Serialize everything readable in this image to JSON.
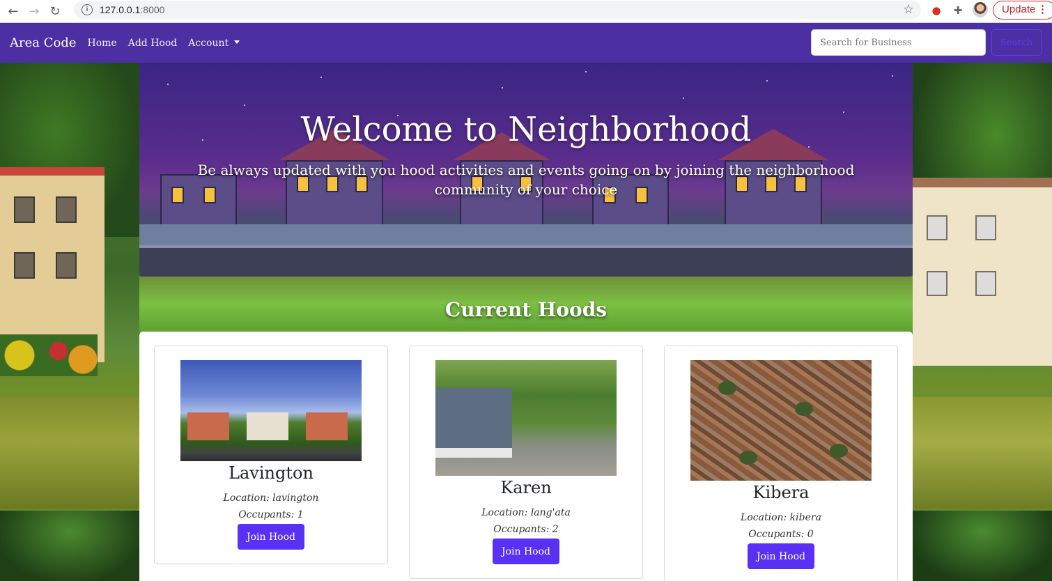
{
  "browser": {
    "url_host": "127.0.0.1",
    "url_port": ":8000",
    "update_label": "Update",
    "update_menu": "⋮"
  },
  "navbar": {
    "brand": "Area Code",
    "links": [
      "Home",
      "Add Hood",
      "Account"
    ],
    "search_placeholder": "Search for Business",
    "search_button": "Search"
  },
  "hero": {
    "title": "Welcome to Neighborhood",
    "subtitle": "Be always updated with you hood activities and events going on by joining the neighborhood community of your choice"
  },
  "section_title": "Current Hoods",
  "hoods": [
    {
      "name": "Lavington",
      "location": "Location: lavington",
      "occupants": "Occupants: 1",
      "button": "Join Hood"
    },
    {
      "name": "Karen",
      "location": "Location: lang'ata",
      "occupants": "Occupants: 2",
      "button": "Join Hood"
    },
    {
      "name": "Kibera",
      "location": "Location: kibera",
      "occupants": "Occupants: 0",
      "button": "Join Hood"
    }
  ],
  "colors": {
    "navbar": "#4c2fa3",
    "primary_button": "#5a31f4"
  },
  "icons": [
    "back-arrow-icon",
    "forward-arrow-icon",
    "reload-icon",
    "info-icon",
    "bookmark-star-icon",
    "extension-icon",
    "puzzle-icon",
    "profile-avatar",
    "dropdown-caret-icon"
  ]
}
